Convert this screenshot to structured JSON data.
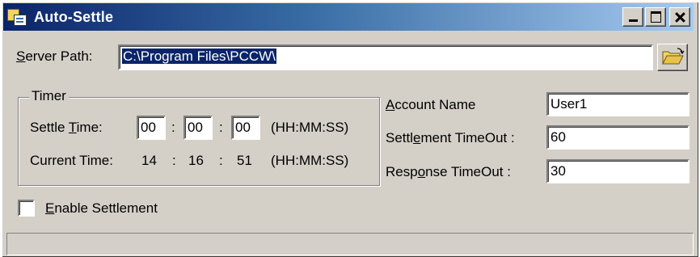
{
  "window": {
    "title": "Auto-Settle"
  },
  "server": {
    "label_accel": "S",
    "label_rest": "erver Path:",
    "path_value": "C:\\Program Files\\PCCW\\"
  },
  "timer": {
    "group_title": "Timer",
    "settle_label_pre": "Settle ",
    "settle_label_accel": "T",
    "settle_label_post": "ime:",
    "settle_hh": "00",
    "settle_mm": "00",
    "settle_ss": "00",
    "colon": ":",
    "format_hint": "(HH:MM:SS)",
    "current_label": "Current Time:",
    "current_hh": "14",
    "current_mm": "16",
    "current_ss": "51"
  },
  "account": {
    "label_accel": "A",
    "label_rest": "ccount Name",
    "value": "User1"
  },
  "settlement_timeout": {
    "label_pre": "Settl",
    "label_accel": "e",
    "label_post": "ment TimeOut :",
    "value": "60"
  },
  "response_timeout": {
    "label_pre": "Resp",
    "label_accel": "o",
    "label_post": "nse TimeOut :",
    "value": "30"
  },
  "enable_settlement": {
    "label_accel": "E",
    "label_rest": "nable Settlement",
    "checked": false
  },
  "statusbar": {
    "text": ""
  },
  "icons": {
    "app": "app-icon",
    "folder": "folder-open-icon",
    "minimize": "minimize-icon",
    "maximize": "maximize-icon",
    "close": "close-icon"
  },
  "colors": {
    "face": "#d4d0c8",
    "title_start": "#0a246a",
    "title_end": "#a6caf0",
    "selection": "#0a246a"
  }
}
